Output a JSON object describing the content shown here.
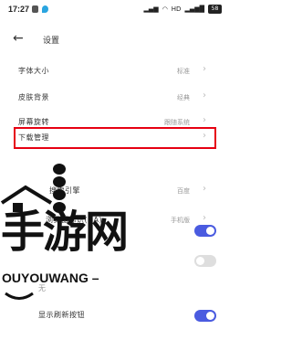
{
  "status_bar": {
    "time": "17:27",
    "right_text": "HD",
    "battery": "58"
  },
  "header": {
    "title": "设置"
  },
  "settings": [
    {
      "label": "字体大小",
      "value": "标准"
    },
    {
      "label": "皮肤背景",
      "value": "经典"
    },
    {
      "label": "屏幕旋转",
      "value": "跟随系统"
    },
    {
      "label": "下载管理",
      "value": ""
    },
    {
      "label": "搜索引擎",
      "value": "百度"
    },
    {
      "label": "浏览器标识(UA)",
      "value": "手机版"
    },
    {
      "label": "",
      "value": ""
    },
    {
      "label": "无",
      "value": ""
    },
    {
      "label": "显示刷新按钮",
      "value": ""
    }
  ],
  "toggles": [
    {
      "state": "on"
    },
    {
      "state": "off"
    },
    {
      "state": "on"
    }
  ],
  "watermark": {
    "main": "手游网",
    "sub": "OUYOUWANG –"
  },
  "colors": {
    "accent": "#4a5be0",
    "highlight": "#e60012",
    "toggle_off": "#dedede"
  }
}
